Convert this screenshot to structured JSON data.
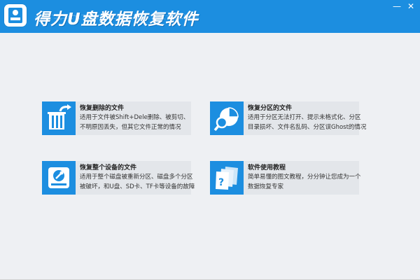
{
  "window": {
    "title": "得力U盘数据恢复软件",
    "minimize_glyph": "—",
    "close_glyph": "✕"
  },
  "colors": {
    "titlebar": "#1c8ee0",
    "icon_tile": "#1c8ee0",
    "background": "#eef0f3",
    "card": "#e3e6ea"
  },
  "cards": [
    {
      "title": "恢复删除的文件",
      "desc_lines": [
        "适用于文件被Shift+Dele删除、被剪切、",
        "不明原因丢失，但其它文件正常的情况"
      ],
      "icon": "trash-restore-icon"
    },
    {
      "title": "恢复分区的文件",
      "desc_lines": [
        "适用于分区无法打开、提示未格式化、分区",
        "目录损坏、文件名乱码、分区误Ghost的情况"
      ],
      "icon": "pie-search-icon"
    },
    {
      "title": "恢复整个设备的文件",
      "desc_lines": [
        "适用于整个磁盘被重新分区、磁盘多个分区",
        "被破坏，和U盘、SD卡、TF卡等设备的故障"
      ],
      "icon": "disk-wrench-icon"
    },
    {
      "title": "软件使用教程",
      "desc_lines": [
        "简单易懂的图文教程，分分钟让您成为一个",
        "数据恢复专家"
      ],
      "icon": "help-pages-icon"
    }
  ]
}
